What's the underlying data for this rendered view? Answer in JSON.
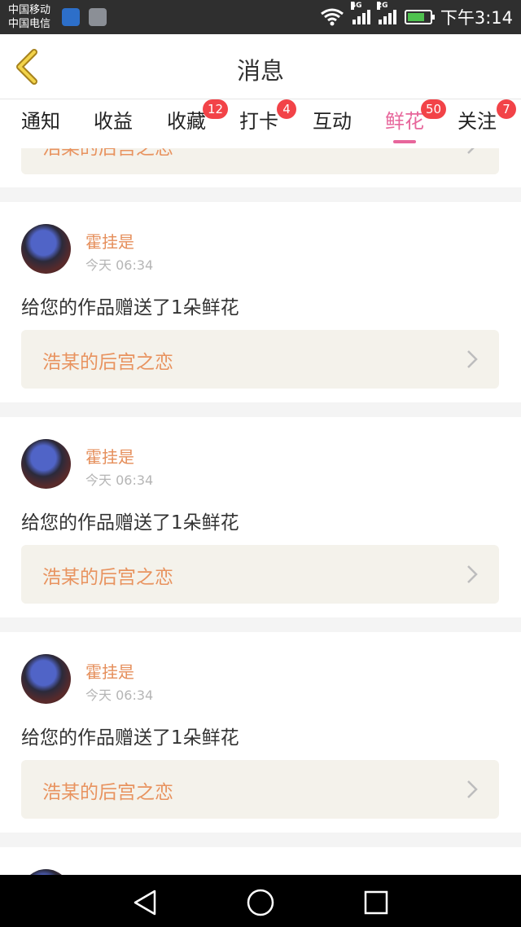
{
  "status": {
    "carrier1": "中国移动",
    "carrier2": "中国电信",
    "net1": "4G",
    "net2": "2G",
    "time": "下午3:14"
  },
  "header": {
    "title": "消息"
  },
  "tabs": [
    {
      "label": "通知",
      "badge": ""
    },
    {
      "label": "收益",
      "badge": ""
    },
    {
      "label": "收藏",
      "badge": "12"
    },
    {
      "label": "打卡",
      "badge": "4"
    },
    {
      "label": "互动",
      "badge": ""
    },
    {
      "label": "鲜花",
      "badge": "50",
      "active": true
    },
    {
      "label": "关注",
      "badge": "7"
    }
  ],
  "partial_top": {
    "work_title": "浩某的后宫之恋"
  },
  "cards": [
    {
      "name": "霍挂是",
      "time": "今天 06:34",
      "message": "给您的作品赠送了1朵鲜花",
      "work_title": "浩某的后宫之恋"
    },
    {
      "name": "霍挂是",
      "time": "今天 06:34",
      "message": "给您的作品赠送了1朵鲜花",
      "work_title": "浩某的后宫之恋"
    },
    {
      "name": "霍挂是",
      "time": "今天 06:34",
      "message": "给您的作品赠送了1朵鲜花",
      "work_title": "浩某的后宫之恋"
    }
  ],
  "colors": {
    "accent": "#e7669b",
    "name": "#e58e5a",
    "badge": "#f24348"
  }
}
